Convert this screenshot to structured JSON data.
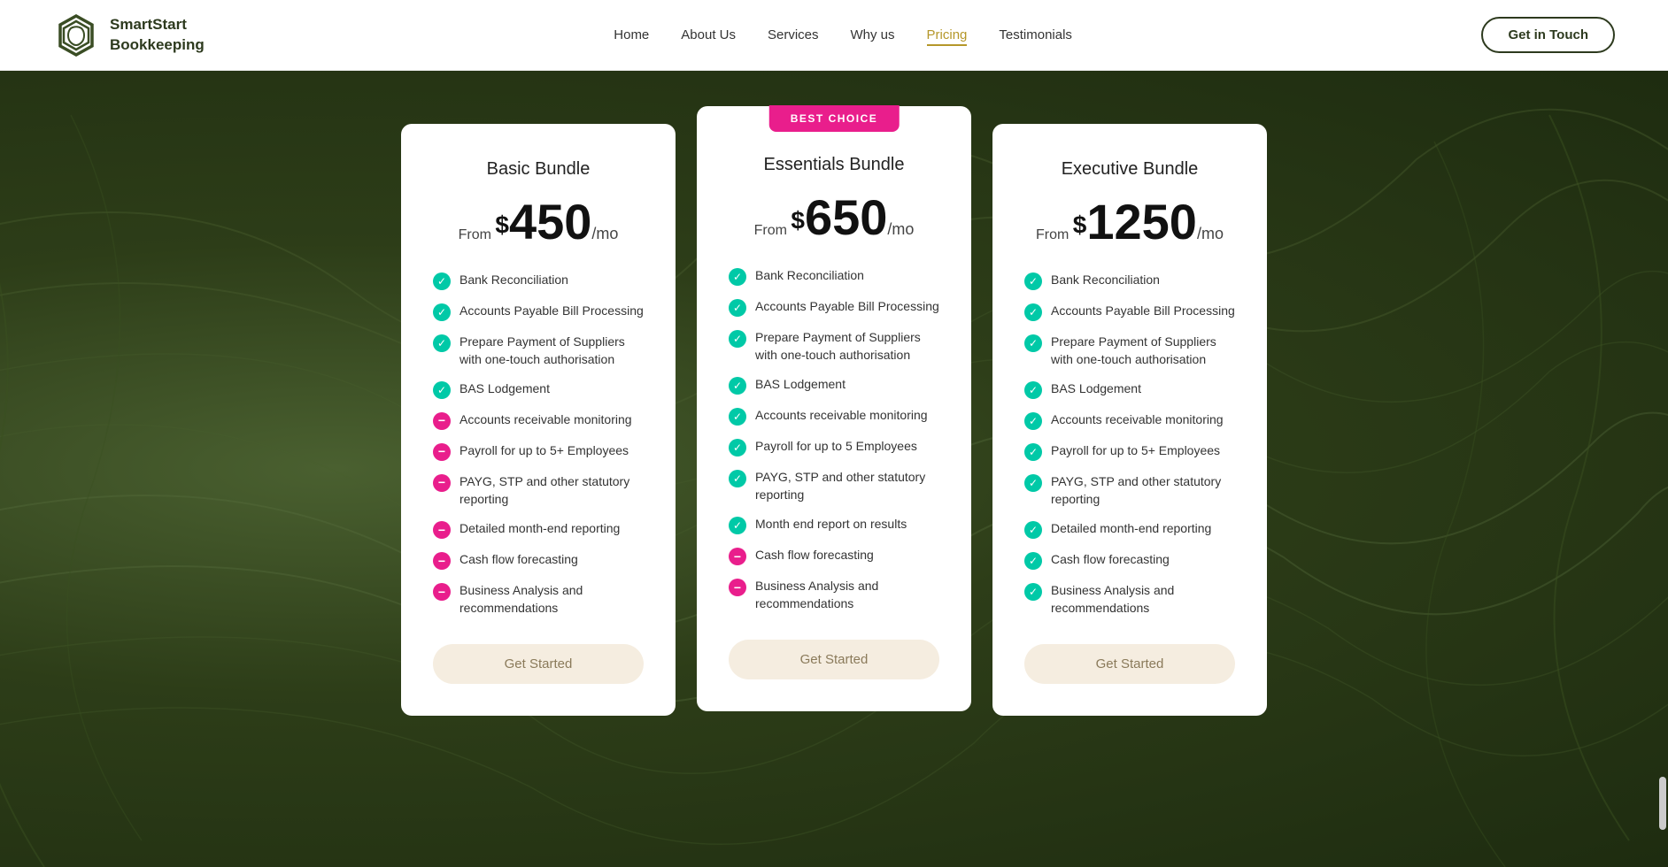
{
  "brand": {
    "logo_text_line1": "SmartStart",
    "logo_text_line2": "Bookkeeping"
  },
  "nav": {
    "links": [
      {
        "label": "Home",
        "active": false
      },
      {
        "label": "About Us",
        "active": false
      },
      {
        "label": "Services",
        "active": false
      },
      {
        "label": "Why us",
        "active": false
      },
      {
        "label": "Pricing",
        "active": true
      },
      {
        "label": "Testimonials",
        "active": false
      }
    ],
    "cta": "Get in Touch"
  },
  "pricing": {
    "best_choice_badge": "BEST CHOICE",
    "cards": [
      {
        "id": "basic",
        "title": "Basic Bundle",
        "from_label": "From",
        "price": "450",
        "mo_label": "/mo",
        "featured": false,
        "features": [
          {
            "text": "Bank Reconciliation",
            "included": true
          },
          {
            "text": "Accounts Payable Bill Processing",
            "included": true
          },
          {
            "text": "Prepare Payment of Suppliers with one-touch authorisation",
            "included": true
          },
          {
            "text": "BAS Lodgement",
            "included": true
          },
          {
            "text": "Accounts receivable monitoring",
            "included": false
          },
          {
            "text": "Payroll for up to 5+ Employees",
            "included": false
          },
          {
            "text": "PAYG, STP and other statutory reporting",
            "included": false
          },
          {
            "text": "Detailed month-end reporting",
            "included": false
          },
          {
            "text": "Cash flow forecasting",
            "included": false
          },
          {
            "text": "Business Analysis and recommendations",
            "included": false
          }
        ],
        "cta": "Get Started"
      },
      {
        "id": "essentials",
        "title": "Essentials Bundle",
        "from_label": "From",
        "price": "650",
        "mo_label": "/mo",
        "featured": true,
        "features": [
          {
            "text": "Bank Reconciliation",
            "included": true
          },
          {
            "text": "Accounts Payable Bill Processing",
            "included": true
          },
          {
            "text": "Prepare Payment of Suppliers with one-touch authorisation",
            "included": true
          },
          {
            "text": "BAS Lodgement",
            "included": true
          },
          {
            "text": "Accounts receivable monitoring",
            "included": true
          },
          {
            "text": "Payroll for up to 5 Employees",
            "included": true
          },
          {
            "text": "PAYG, STP and other statutory reporting",
            "included": true
          },
          {
            "text": "Month end report on results",
            "included": true
          },
          {
            "text": "Cash flow forecasting",
            "included": false
          },
          {
            "text": "Business Analysis and recommendations",
            "included": false
          }
        ],
        "cta": "Get Started"
      },
      {
        "id": "executive",
        "title": "Executive Bundle",
        "from_label": "From",
        "price": "1250",
        "mo_label": "/mo",
        "featured": false,
        "features": [
          {
            "text": "Bank Reconciliation",
            "included": true
          },
          {
            "text": "Accounts Payable Bill Processing",
            "included": true
          },
          {
            "text": "Prepare Payment of Suppliers with one-touch authorisation",
            "included": true
          },
          {
            "text": "BAS Lodgement",
            "included": true
          },
          {
            "text": "Accounts receivable monitoring",
            "included": true
          },
          {
            "text": "Payroll for up to 5+ Employees",
            "included": true
          },
          {
            "text": "PAYG, STP and other statutory reporting",
            "included": true
          },
          {
            "text": "Detailed month-end reporting",
            "included": true
          },
          {
            "text": "Cash flow forecasting",
            "included": true
          },
          {
            "text": "Business Analysis and recommendations",
            "included": true
          }
        ],
        "cta": "Get Started"
      }
    ]
  }
}
